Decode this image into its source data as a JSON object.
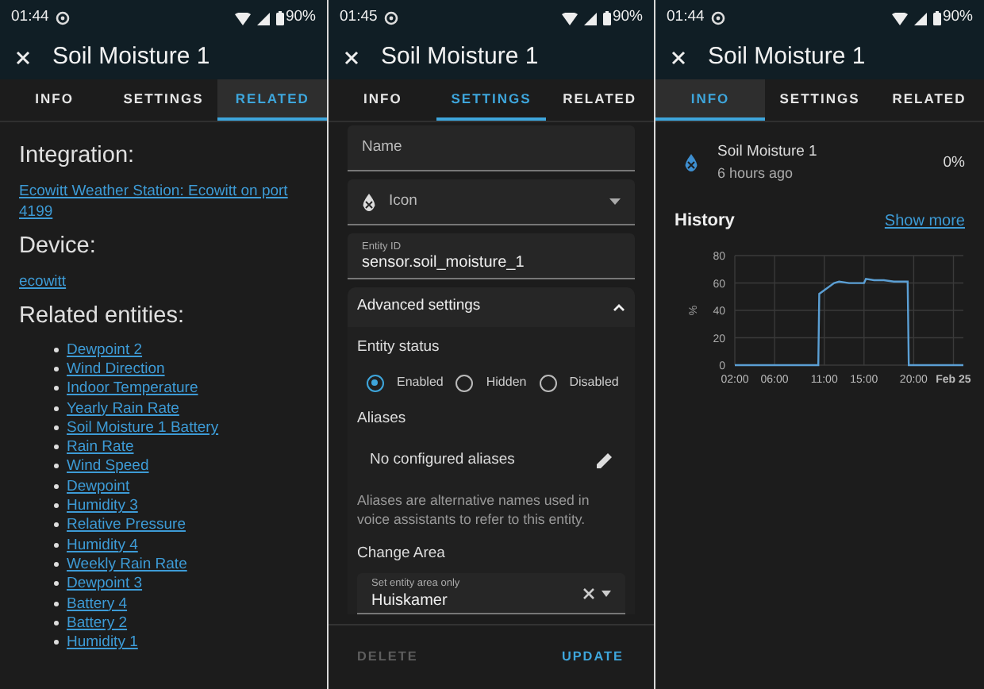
{
  "screens": [
    {
      "kind": "related",
      "status_bar": {
        "time": "01:44",
        "battery": "90%"
      },
      "title": "Soil Moisture 1",
      "tabs": [
        {
          "label": "INFO",
          "selected": false
        },
        {
          "label": "SETTINGS",
          "selected": false
        },
        {
          "label": "RELATED",
          "selected": true
        }
      ],
      "related": {
        "integration_heading": "Integration:",
        "integration_link": "Ecowitt Weather Station: Ecowitt on port 4199",
        "device_heading": "Device:",
        "device_link": "ecowitt",
        "entities_heading": "Related entities:",
        "entities": [
          "Dewpoint 2",
          "Wind Direction",
          "Indoor Temperature",
          "Yearly Rain Rate",
          "Soil Moisture 1 Battery",
          "Rain Rate",
          "Wind Speed",
          "Dewpoint",
          "Humidity 3",
          "Relative Pressure",
          "Humidity 4",
          "Weekly Rain Rate",
          "Dewpoint 3",
          "Battery 4",
          "Battery 2",
          "Humidity 1"
        ]
      }
    },
    {
      "kind": "settings",
      "status_bar": {
        "time": "01:45",
        "battery": "90%"
      },
      "title": "Soil Moisture 1",
      "tabs": [
        {
          "label": "INFO",
          "selected": false
        },
        {
          "label": "SETTINGS",
          "selected": true
        },
        {
          "label": "RELATED",
          "selected": false
        }
      ],
      "settings": {
        "name_placeholder": "Name",
        "icon_placeholder": "Icon",
        "entity_id_label": "Entity ID",
        "entity_id": "sensor.soil_moisture_1",
        "advanced": {
          "title": "Advanced settings",
          "expanded": true
        },
        "status_heading": "Entity status",
        "status_options": [
          {
            "label": "Enabled",
            "selected": true
          },
          {
            "label": "Hidden",
            "selected": false
          },
          {
            "label": "Disabled",
            "selected": false
          }
        ],
        "aliases_heading": "Aliases",
        "aliases_empty": "No configured aliases",
        "aliases_help": "Aliases are alternative names used in voice assistants to refer to this entity.",
        "area_heading": "Change Area",
        "area_label": "Set entity area only",
        "area_value": "Huiskamer",
        "buttons": [
          {
            "label": "DELETE",
            "disabled": true
          },
          {
            "label": "UPDATE",
            "disabled": false
          }
        ]
      }
    },
    {
      "kind": "info",
      "status_bar": {
        "time": "01:44",
        "battery": "90%"
      },
      "title": "Soil Moisture 1",
      "tabs": [
        {
          "label": "INFO",
          "selected": true
        },
        {
          "label": "SETTINGS",
          "selected": false
        },
        {
          "label": "RELATED",
          "selected": false
        }
      ],
      "info": {
        "entity_name": "Soil Moisture 1",
        "last_changed": "6 hours ago",
        "state": "0%",
        "history_heading": "History",
        "show_more": "Show more",
        "chart_data": {
          "type": "line",
          "ylabel": "%",
          "x": [
            2,
            10.4,
            10.5,
            12,
            12.5,
            13.5,
            15,
            15.2,
            16,
            17,
            18,
            19.4,
            19.5,
            25
          ],
          "series": [
            {
              "color": "#5b9fd4",
              "values": [
                0,
                0,
                52,
                60,
                61,
                60,
                60,
                63,
                62,
                62,
                61,
                61,
                0,
                0
              ]
            }
          ],
          "grid": true,
          "xlim": [
            2,
            25
          ],
          "ylim": [
            0,
            80
          ],
          "yticks": [
            0,
            20,
            40,
            60,
            80
          ],
          "xticks": [
            {
              "value": 2,
              "label": "02:00"
            },
            {
              "value": 6,
              "label": "06:00"
            },
            {
              "value": 11,
              "label": "11:00"
            },
            {
              "value": 15,
              "label": "15:00"
            },
            {
              "value": 20,
              "label": "20:00"
            },
            {
              "value": 24,
              "label": "Feb 25"
            }
          ]
        }
      }
    }
  ]
}
